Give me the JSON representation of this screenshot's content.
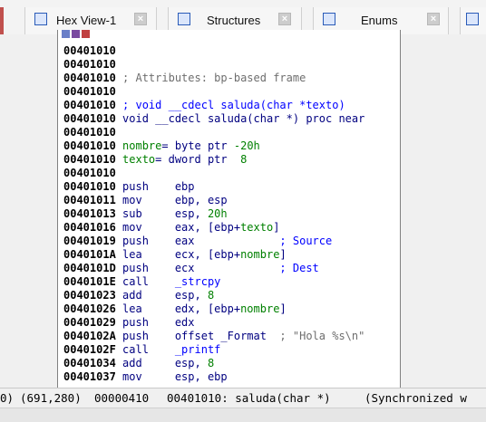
{
  "tabs": [
    {
      "label": "Hex View-1",
      "icon": "hex-view-icon"
    },
    {
      "label": "Structures",
      "icon": "structures-icon"
    },
    {
      "label": "Enums",
      "icon": "enums-icon"
    }
  ],
  "disassembly": {
    "lines": [
      {
        "addr": "00401010",
        "parts": []
      },
      {
        "addr": "00401010",
        "parts": []
      },
      {
        "addr": "00401010",
        "parts": [
          {
            "t": "; Attributes: bp-based frame",
            "c": "cmt"
          }
        ]
      },
      {
        "addr": "00401010",
        "parts": []
      },
      {
        "addr": "00401010",
        "parts": [
          {
            "t": "; void __cdecl saluda(char *texto)",
            "c": "blue"
          }
        ]
      },
      {
        "addr": "00401010",
        "parts": [
          {
            "t": "void __cdecl saluda(char *) proc near",
            "c": "fnhdr"
          }
        ]
      },
      {
        "addr": "00401010",
        "parts": []
      },
      {
        "addr": "00401010",
        "parts": [
          {
            "t": "nombre",
            "c": "varname"
          },
          {
            "t": "= byte ptr ",
            "c": "mnem"
          },
          {
            "t": "-20h",
            "c": "num"
          }
        ]
      },
      {
        "addr": "00401010",
        "parts": [
          {
            "t": "texto",
            "c": "varname"
          },
          {
            "t": "= dword ptr  ",
            "c": "mnem"
          },
          {
            "t": "8",
            "c": "num"
          }
        ]
      },
      {
        "addr": "00401010",
        "parts": []
      },
      {
        "addr": "00401010",
        "parts": [
          {
            "t": "push    ebp",
            "c": "mnem"
          }
        ]
      },
      {
        "addr": "00401011",
        "parts": [
          {
            "t": "mov     ebp, esp",
            "c": "mnem"
          }
        ]
      },
      {
        "addr": "00401013",
        "parts": [
          {
            "t": "sub     esp, ",
            "c": "mnem"
          },
          {
            "t": "20h",
            "c": "num"
          }
        ]
      },
      {
        "addr": "00401016",
        "parts": [
          {
            "t": "mov     eax, [ebp+",
            "c": "mnem"
          },
          {
            "t": "texto",
            "c": "varname"
          },
          {
            "t": "]",
            "c": "mnem"
          }
        ]
      },
      {
        "addr": "00401019",
        "parts": [
          {
            "t": "push    eax             ",
            "c": "mnem"
          },
          {
            "t": "; Source",
            "c": "blue"
          }
        ]
      },
      {
        "addr": "0040101A",
        "parts": [
          {
            "t": "lea     ecx, [ebp+",
            "c": "mnem"
          },
          {
            "t": "nombre",
            "c": "varname"
          },
          {
            "t": "]",
            "c": "mnem"
          }
        ]
      },
      {
        "addr": "0040101D",
        "parts": [
          {
            "t": "push    ecx             ",
            "c": "mnem"
          },
          {
            "t": "; Dest",
            "c": "blue"
          }
        ]
      },
      {
        "addr": "0040101E",
        "parts": [
          {
            "t": "call    ",
            "c": "mnem"
          },
          {
            "t": "_strcpy",
            "c": "blue"
          }
        ]
      },
      {
        "addr": "00401023",
        "parts": [
          {
            "t": "add     esp, ",
            "c": "mnem"
          },
          {
            "t": "8",
            "c": "num"
          }
        ]
      },
      {
        "addr": "00401026",
        "parts": [
          {
            "t": "lea     edx, [ebp+",
            "c": "mnem"
          },
          {
            "t": "nombre",
            "c": "varname"
          },
          {
            "t": "]",
            "c": "mnem"
          }
        ]
      },
      {
        "addr": "00401029",
        "parts": [
          {
            "t": "push    edx",
            "c": "mnem"
          }
        ]
      },
      {
        "addr": "0040102A",
        "parts": [
          {
            "t": "push    offset _Format  ",
            "c": "mnem"
          },
          {
            "t": "; \"Hola %s\\n\"",
            "c": "cmt"
          }
        ]
      },
      {
        "addr": "0040102F",
        "parts": [
          {
            "t": "call    ",
            "c": "mnem"
          },
          {
            "t": "_printf",
            "c": "blue"
          }
        ]
      },
      {
        "addr": "00401034",
        "parts": [
          {
            "t": "add     esp, ",
            "c": "mnem"
          },
          {
            "t": "8",
            "c": "num"
          }
        ]
      },
      {
        "addr": "00401037",
        "parts": [
          {
            "t": "mov     esp, ebp",
            "c": "mnem"
          }
        ]
      }
    ]
  },
  "status": {
    "paren": "0)",
    "coords": "(691,280)",
    "offset": "00000410",
    "location": "00401010: saluda(char *)",
    "sync": "(Synchronized w"
  },
  "colors": {
    "accent": "#2a5bb8",
    "addr": "#000000",
    "code": "#000080",
    "var": "#008000"
  }
}
